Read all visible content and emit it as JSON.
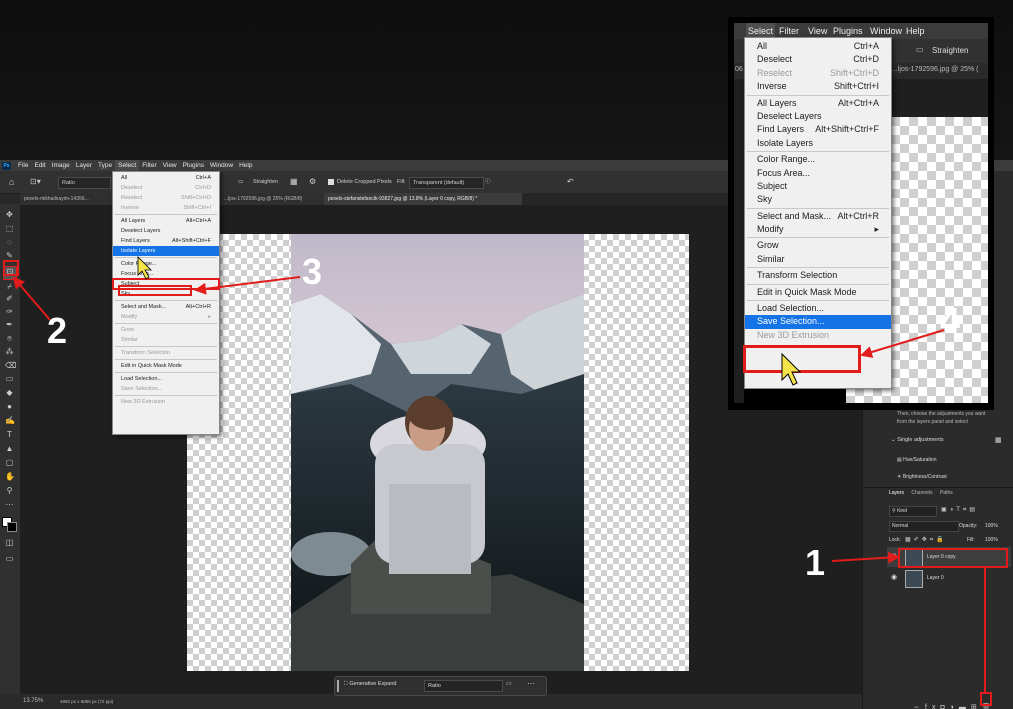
{
  "app": {
    "logo": "Ps",
    "menus": [
      "File",
      "Edit",
      "Image",
      "Layer",
      "Type",
      "Select",
      "Filter",
      "View",
      "Plugins",
      "Window",
      "Help"
    ],
    "active_menu": "Select"
  },
  "options_bar": {
    "ratio_label": "Ratio",
    "straighten_label": "Straighten",
    "delete_cropped_label": "Delete Cropped Pixels",
    "fill_label": "Fill:",
    "fill_value": "Transparent (default)"
  },
  "tabs": [
    {
      "label": "pexels-mikhailnayim-14356..."
    },
    {
      "label": "...ljos-1792596.jpg @ 25% (RGB/8)"
    },
    {
      "label": "pexels-stefanstefancik-93827.jpg @ 13.8% (Layer 0 copy, RGB/8) *"
    }
  ],
  "select_menu": {
    "items": [
      {
        "label": "All",
        "shortcut": "Ctrl+A",
        "disabled": false,
        "sep_before": false
      },
      {
        "label": "Deselect",
        "shortcut": "Ctrl+D",
        "disabled": true,
        "sep_before": false
      },
      {
        "label": "Reselect",
        "shortcut": "Shift+Ctrl+D",
        "disabled": true,
        "sep_before": false
      },
      {
        "label": "Inverse",
        "shortcut": "Shift+Ctrl+I",
        "disabled": true,
        "sep_before": false
      },
      {
        "label": "All Layers",
        "shortcut": "Alt+Ctrl+A",
        "disabled": false,
        "sep_before": true
      },
      {
        "label": "Deselect Layers",
        "shortcut": "",
        "disabled": false,
        "sep_before": false
      },
      {
        "label": "Find Layers",
        "shortcut": "Alt+Shift+Ctrl+F",
        "disabled": false,
        "sep_before": false
      },
      {
        "label": "Isolate Layers",
        "shortcut": "",
        "disabled": false,
        "sep_before": false,
        "highlight": true
      },
      {
        "label": "Color Range...",
        "shortcut": "",
        "disabled": false,
        "sep_before": true
      },
      {
        "label": "Focus Area...",
        "shortcut": "",
        "disabled": false,
        "sep_before": false
      },
      {
        "label": "Subject",
        "shortcut": "",
        "disabled": false,
        "sep_before": false,
        "boxed": true
      },
      {
        "label": "Sky",
        "shortcut": "",
        "disabled": false,
        "sep_before": false
      },
      {
        "label": "Select and Mask...",
        "shortcut": "Alt+Ctrl+R",
        "disabled": false,
        "sep_before": true
      },
      {
        "label": "Modify",
        "shortcut": "▸",
        "disabled": true,
        "sep_before": false
      },
      {
        "label": "Grow",
        "shortcut": "",
        "disabled": true,
        "sep_before": true
      },
      {
        "label": "Similar",
        "shortcut": "",
        "disabled": true,
        "sep_before": false
      },
      {
        "label": "Transform Selection",
        "shortcut": "",
        "disabled": true,
        "sep_before": true
      },
      {
        "label": "Edit in Quick Mask Mode",
        "shortcut": "",
        "disabled": false,
        "sep_before": true
      },
      {
        "label": "Load Selection...",
        "shortcut": "",
        "disabled": false,
        "sep_before": true
      },
      {
        "label": "Save Selection...",
        "shortcut": "",
        "disabled": true,
        "sep_before": false
      },
      {
        "label": "New 3D Extrusion",
        "shortcut": "",
        "disabled": true,
        "sep_before": true
      }
    ]
  },
  "zoom_menu": {
    "menubar": [
      "Select",
      "Filter",
      "View",
      "Plugins",
      "Window",
      "Help"
    ],
    "straighten_label": "Straighten",
    "tab_fragment": "...ljos-1792596.jpg @ 25% (",
    "tab_prefix": "06",
    "items": [
      {
        "label": "All",
        "shortcut": "Ctrl+A",
        "disabled": false,
        "sep_before": false
      },
      {
        "label": "Deselect",
        "shortcut": "Ctrl+D",
        "disabled": false,
        "sep_before": false
      },
      {
        "label": "Reselect",
        "shortcut": "Shift+Ctrl+D",
        "disabled": true,
        "sep_before": false
      },
      {
        "label": "Inverse",
        "shortcut": "Shift+Ctrl+I",
        "disabled": false,
        "sep_before": false
      },
      {
        "label": "All Layers",
        "shortcut": "Alt+Ctrl+A",
        "disabled": false,
        "sep_before": true
      },
      {
        "label": "Deselect Layers",
        "shortcut": "",
        "disabled": false,
        "sep_before": false
      },
      {
        "label": "Find Layers",
        "shortcut": "Alt+Shift+Ctrl+F",
        "disabled": false,
        "sep_before": false
      },
      {
        "label": "Isolate Layers",
        "shortcut": "",
        "disabled": false,
        "sep_before": false
      },
      {
        "label": "Color Range...",
        "shortcut": "",
        "disabled": false,
        "sep_before": true
      },
      {
        "label": "Focus Area...",
        "shortcut": "",
        "disabled": false,
        "sep_before": false
      },
      {
        "label": "Subject",
        "shortcut": "",
        "disabled": false,
        "sep_before": false
      },
      {
        "label": "Sky",
        "shortcut": "",
        "disabled": false,
        "sep_before": false
      },
      {
        "label": "Select and Mask...",
        "shortcut": "Alt+Ctrl+R",
        "disabled": false,
        "sep_before": true
      },
      {
        "label": "Modify",
        "shortcut": "▸",
        "disabled": false,
        "sep_before": false
      },
      {
        "label": "Grow",
        "shortcut": "",
        "disabled": false,
        "sep_before": true
      },
      {
        "label": "Similar",
        "shortcut": "",
        "disabled": false,
        "sep_before": false
      },
      {
        "label": "Transform Selection",
        "shortcut": "",
        "disabled": false,
        "sep_before": true
      },
      {
        "label": "Edit in Quick Mask Mode",
        "shortcut": "",
        "disabled": false,
        "sep_before": true
      },
      {
        "label": "Load Selection...",
        "shortcut": "",
        "disabled": false,
        "sep_before": true
      },
      {
        "label": "Save Selection...",
        "shortcut": "",
        "disabled": false,
        "sep_before": false,
        "highlight": true
      },
      {
        "label": "New 3D Extrusion",
        "shortcut": "",
        "disabled": true,
        "sep_before": false
      }
    ]
  },
  "right_panel": {
    "adjust_hint_1": "Then, choose the adjustments you want",
    "adjust_hint_2": "from the layers panel and select",
    "single_adjustments": "Single adjustments",
    "adj_1": "Hue/Saturation",
    "adj_2": "Brightness/Contrast",
    "layer_tabs": [
      "Layers",
      "Channels",
      "Paths"
    ],
    "kind_label": "Kind",
    "blend_mode": "Normal",
    "opacity_label": "Opacity:",
    "opacity_value": "100%",
    "lock_label": "Lock:",
    "fill_label": "Fill:",
    "fill_value": "100%",
    "layers": [
      {
        "name": "Layer 0 copy"
      },
      {
        "name": "Layer 0"
      }
    ]
  },
  "status": {
    "zoom": "13.75%",
    "doc_info": "4892 px x 6856 px (72 ppi)"
  },
  "context_bar": {
    "generative_expand": "Generative Expand",
    "ratio": "Ratio"
  },
  "annotations": {
    "n1": "1",
    "n2": "2",
    "n3": "3",
    "n4": "4"
  },
  "colors": {
    "annotation_red": "#e21b1b",
    "highlight_blue": "#1473e6",
    "app_bg": "#282828"
  }
}
